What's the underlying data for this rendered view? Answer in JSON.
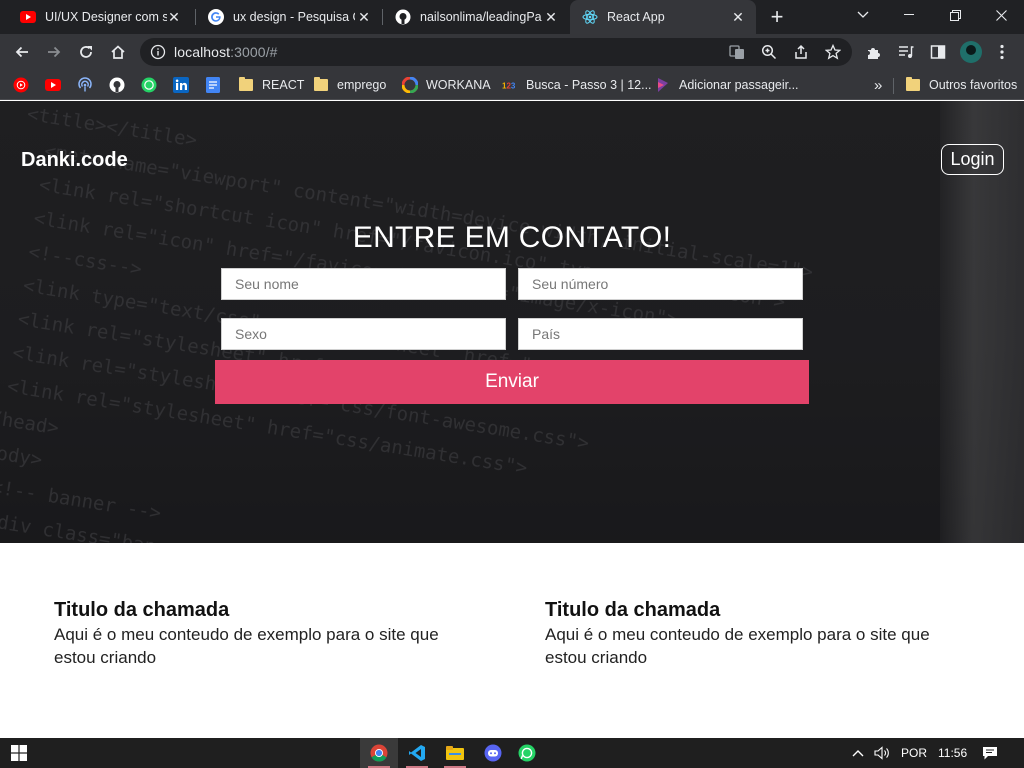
{
  "browser": {
    "tabs": [
      {
        "title": "UI/UX Designer com salário",
        "favicon": "youtube-icon",
        "active": false
      },
      {
        "title": "ux design - Pesquisa Google",
        "favicon": "google-icon",
        "active": false
      },
      {
        "title": "nailsonlima/leadingPage",
        "favicon": "github-icon",
        "active": false
      },
      {
        "title": "React App",
        "favicon": "react-icon",
        "active": true
      }
    ],
    "url_host": "localhost",
    "url_rest": ":3000/#",
    "bookmarks": [
      {
        "label": "",
        "icon": "youtube-music-icon"
      },
      {
        "label": "",
        "icon": "youtube-icon"
      },
      {
        "label": "",
        "icon": "podcast-icon"
      },
      {
        "label": "",
        "icon": "github-icon"
      },
      {
        "label": "",
        "icon": "whatsapp-icon"
      },
      {
        "label": "",
        "icon": "linkedin-icon"
      },
      {
        "label": "",
        "icon": "google-docs-icon"
      },
      {
        "label": "REACT",
        "icon": "folder-icon"
      },
      {
        "label": "emprego",
        "icon": "folder-icon"
      },
      {
        "label": "WORKANA",
        "icon": "workana-icon"
      },
      {
        "label": "Busca - Passo 3 | 12...",
        "icon": "123milhas-icon"
      },
      {
        "label": "Adicionar passageir...",
        "icon": "airline-icon"
      }
    ],
    "overflow": "»",
    "other_bookmarks": "Outros favoritos"
  },
  "page": {
    "brand": "Danki.code",
    "login": "Login",
    "contact": {
      "title": "ENTRE EM CONTATO!",
      "name_placeholder": "Seu nome",
      "phone_placeholder": "Seu número",
      "gender_placeholder": "Sexo",
      "country_placeholder": "País",
      "submit": "Enviar"
    },
    "features": [
      {
        "title": "Titulo da chamada",
        "text": "Aqui é o meu conteudo de exemplo para o site que estou criando"
      },
      {
        "title": "Titulo da chamada",
        "text": "Aqui é o meu conteudo de exemplo para o site que estou criando"
      }
    ]
  },
  "taskbar": {
    "apps": [
      "chrome-icon",
      "vscode-icon",
      "file-explorer-icon",
      "discord-icon",
      "whatsapp-icon"
    ],
    "language": "POR",
    "time": "11:56"
  },
  "colors": {
    "accent": "#e3436a",
    "hero_background": "#232325",
    "browser_frame": "#202124",
    "toolbar": "#35363a"
  }
}
